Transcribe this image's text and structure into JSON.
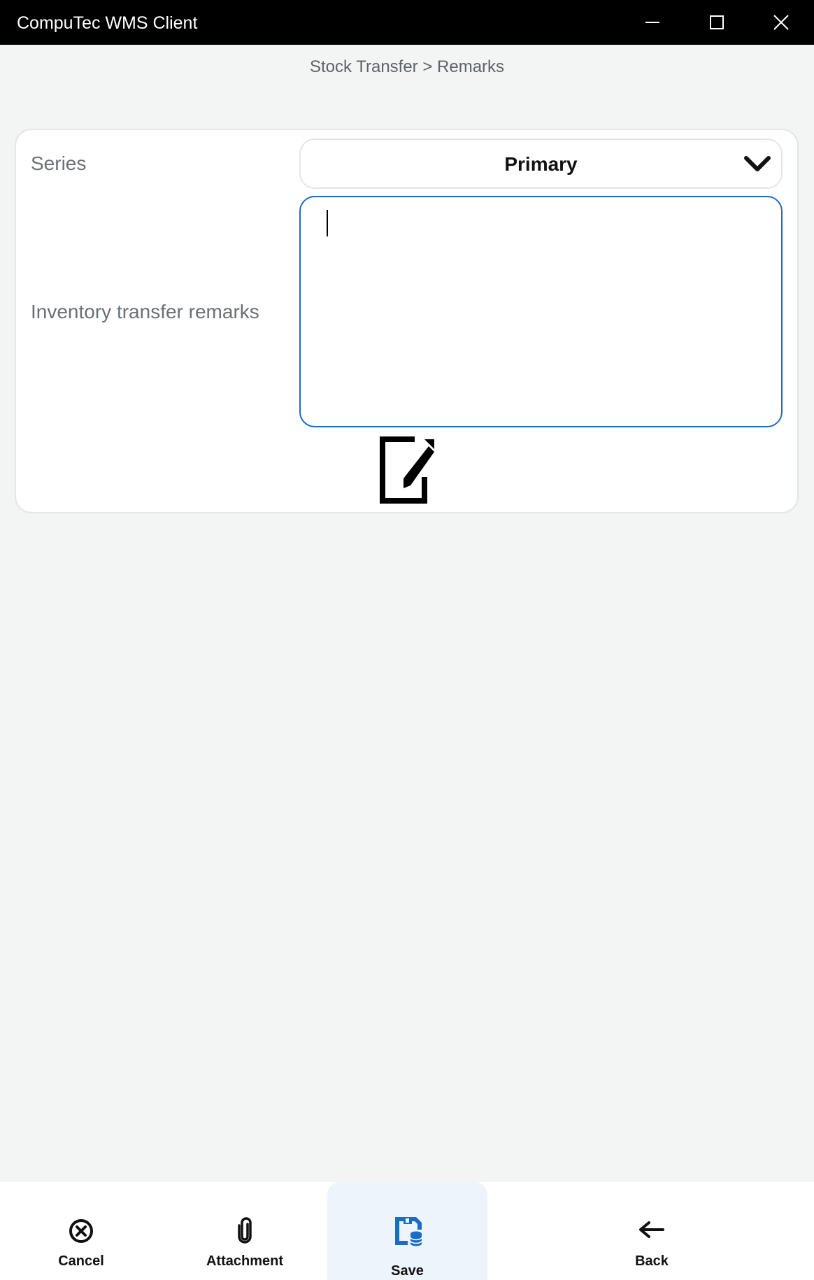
{
  "window": {
    "title": "CompuTec WMS Client"
  },
  "breadcrumb": "Stock Transfer > Remarks",
  "form": {
    "series_label": "Series",
    "series_value": "Primary",
    "remarks_label": "Inventory transfer remarks",
    "remarks_value": ""
  },
  "icons": {
    "minimize": "minimize-icon",
    "maximize": "maximize-icon",
    "close": "close-icon",
    "dropdown": "chevron-down-icon",
    "edit": "edit-note-icon",
    "cancel": "cancel-circle-icon",
    "attachment": "paperclip-icon",
    "save": "save-database-icon",
    "back": "arrow-left-icon"
  },
  "bottom_nav": {
    "cancel": "Cancel",
    "attachment": "Attachment",
    "save": "Save",
    "back": "Back"
  },
  "colors": {
    "accent": "#1a6cc7",
    "titlebar": "#000000",
    "background": "#f3f5f5"
  }
}
